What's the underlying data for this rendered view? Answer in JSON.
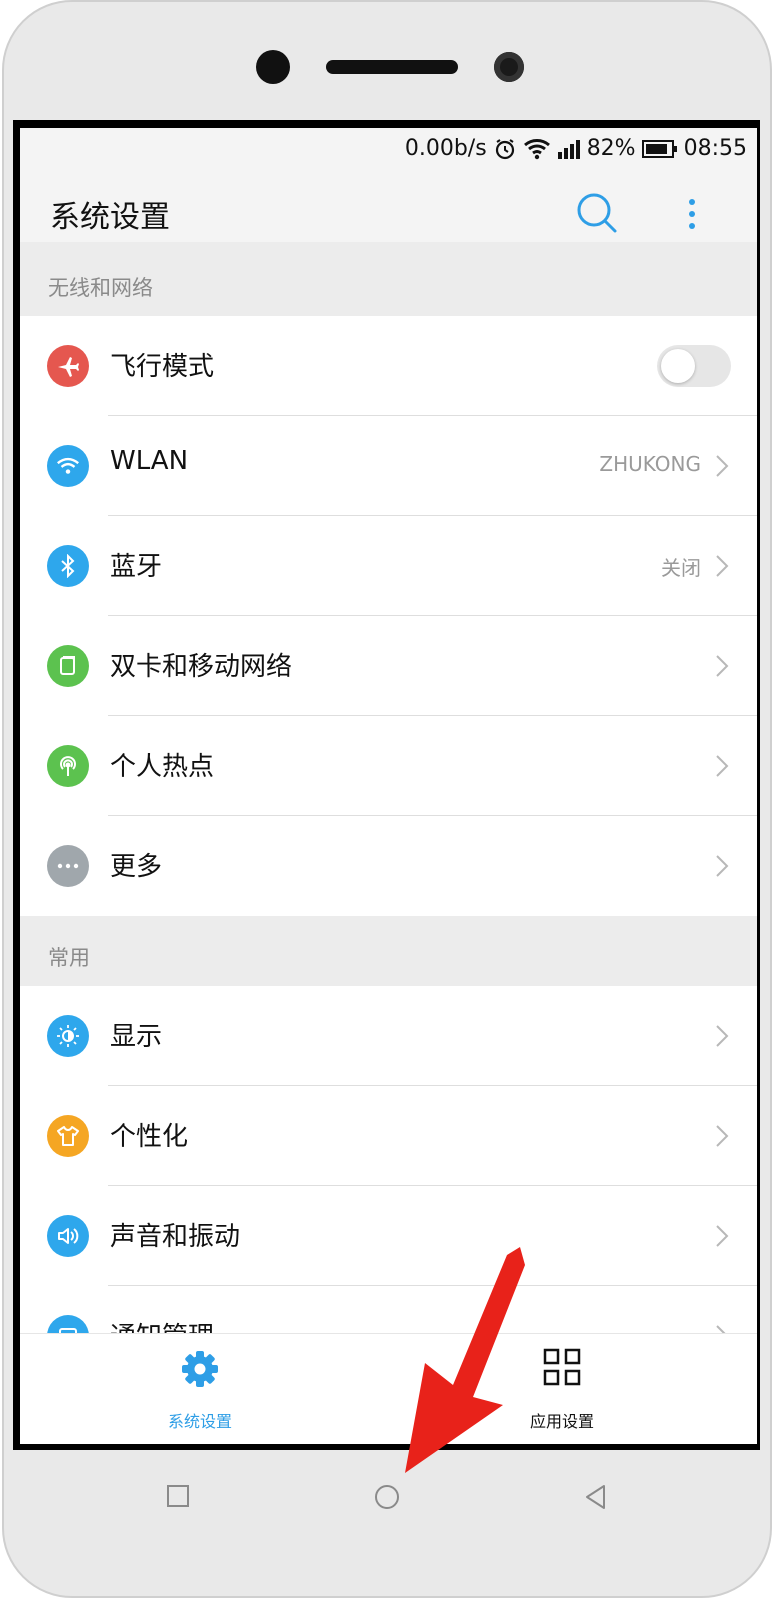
{
  "status": {
    "speed": "0.00b/s",
    "battery": "82%",
    "time": "08:55"
  },
  "appbar": {
    "title": "系统设置"
  },
  "sections": {
    "wireless": {
      "title": "无线和网络"
    },
    "common": {
      "title": "常用"
    }
  },
  "rows": [
    {
      "label": "飞行模式",
      "icon": "airplane-icon",
      "color": "#e5574f",
      "toggle": "off"
    },
    {
      "label": "WLAN",
      "value": "ZHUKONG",
      "icon": "wifi-icon",
      "color": "#2ea7ec"
    },
    {
      "label": "蓝牙",
      "value": "关闭",
      "icon": "bluetooth-icon",
      "color": "#2ea7ec"
    },
    {
      "label": "双卡和移动网络",
      "icon": "sim-card-icon",
      "color": "#5cc24f"
    },
    {
      "label": "个人热点",
      "icon": "hotspot-icon",
      "color": "#5cc24f"
    },
    {
      "label": "更多",
      "icon": "more-dots-icon",
      "color": "#a0a7ac"
    },
    {
      "label": "显示",
      "icon": "brightness-icon",
      "color": "#2ea7ec"
    },
    {
      "label": "个性化",
      "icon": "tshirt-icon",
      "color": "#f5a623"
    },
    {
      "label": "声音和振动",
      "icon": "speaker-icon",
      "color": "#2ea7ec"
    },
    {
      "label": "通知管理",
      "icon": "notification-icon",
      "color": "#2ea7ec"
    }
  ],
  "bottom_tabs": [
    {
      "label": "系统设置",
      "icon": "gear-icon",
      "active": true,
      "color": "#2e9ee6"
    },
    {
      "label": "应用设置",
      "icon": "grid-icon",
      "active": false,
      "color": "#111111"
    }
  ],
  "colors": {
    "accent": "#2e9ee6",
    "annotation_arrow": "#e8221a"
  }
}
